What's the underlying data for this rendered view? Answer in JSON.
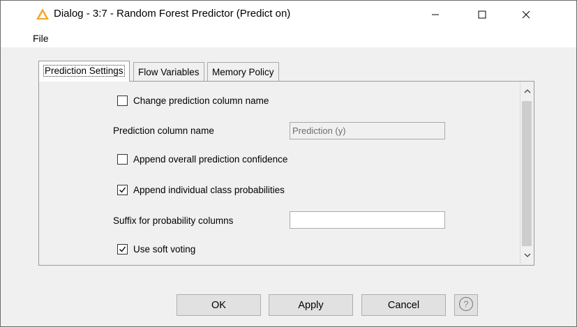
{
  "window": {
    "title": "Dialog - 3:7 - Random Forest Predictor (Predict on)",
    "icons": {
      "app": "knime-triangle-icon",
      "minimize": "minimize-icon",
      "maximize": "maximize-icon",
      "close": "close-icon"
    }
  },
  "menu": {
    "file": "File"
  },
  "tabs": [
    {
      "label": "Prediction Settings",
      "active": true
    },
    {
      "label": "Flow Variables",
      "active": false
    },
    {
      "label": "Memory Policy",
      "active": false
    }
  ],
  "settings": {
    "change_prediction_column_name": {
      "label": "Change prediction column name",
      "checked": false
    },
    "prediction_column_name": {
      "label": "Prediction column name",
      "value": "Prediction (y)",
      "enabled": false
    },
    "append_overall_confidence": {
      "label": "Append overall prediction confidence",
      "checked": false
    },
    "append_class_probabilities": {
      "label": "Append individual class probabilities",
      "checked": true
    },
    "suffix_probability_columns": {
      "label": "Suffix for probability columns",
      "value": ""
    },
    "use_soft_voting": {
      "label": "Use soft voting",
      "checked": true
    }
  },
  "buttons": {
    "ok": "OK",
    "apply": "Apply",
    "cancel": "Cancel",
    "help_icon": "help-icon"
  }
}
